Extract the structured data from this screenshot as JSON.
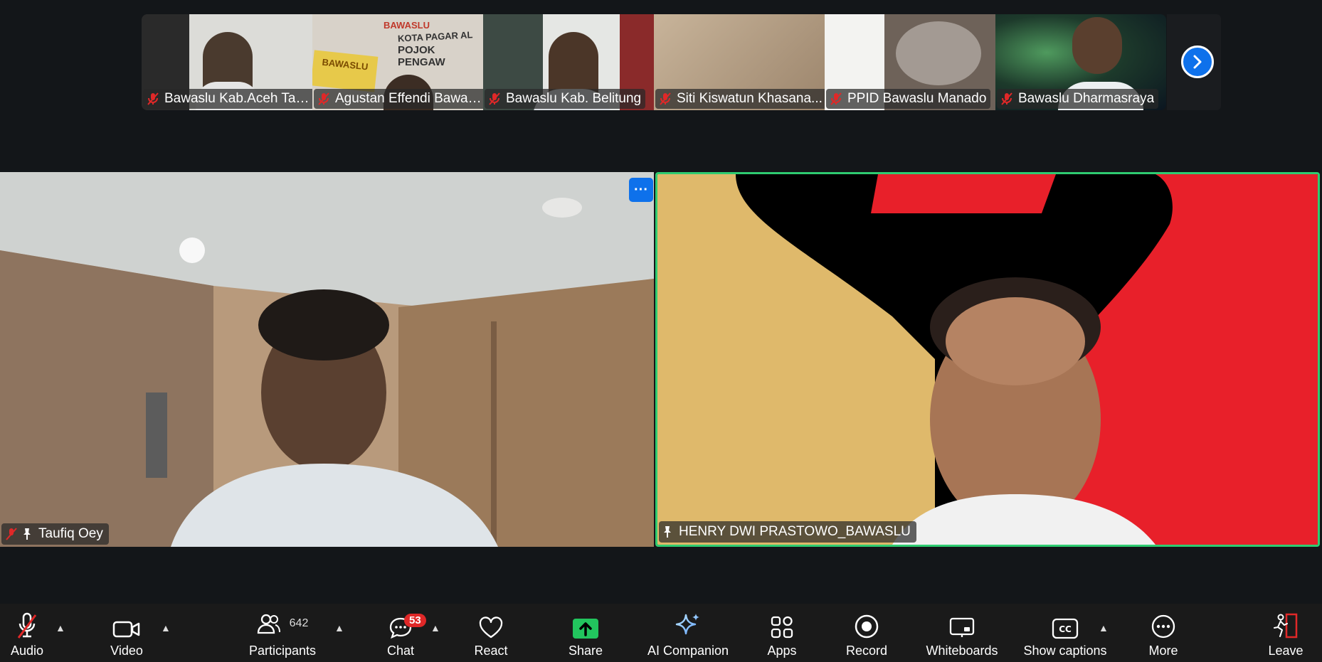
{
  "thumbnails": [
    {
      "name": "Bawaslu Kab.Aceh Tam...",
      "muted": true,
      "bg": "#c9c6c0"
    },
    {
      "name": "Agustan Effendi Bawas...",
      "muted": true,
      "bg": "#d8d2c9",
      "sign_lines": [
        "BAWASLU",
        "KOTA PAGAR AL",
        "POJOK PENGAW"
      ],
      "badge_text": "BAWASLU"
    },
    {
      "name": "Bawaslu Kab. Belitung",
      "muted": true,
      "bg": "#5b6b62"
    },
    {
      "name": "Siti Kiswatun Khasana...",
      "muted": true,
      "bg": "#b49d84"
    },
    {
      "name": "PPID Bawaslu Manado",
      "muted": true,
      "bg": "#8d8179"
    },
    {
      "name": "Bawaslu Dharmasraya",
      "muted": true,
      "bg": "#1f3b2c"
    }
  ],
  "main": {
    "left": {
      "name": "Taufiq Oey",
      "muted": true,
      "pinned": true
    },
    "right": {
      "name": "HENRY DWI PRASTOWO_BAWASLU",
      "pinned": true,
      "active_speaker": true
    }
  },
  "toolbar": {
    "audio": "Audio",
    "video": "Video",
    "participants": "Participants",
    "participants_count": "642",
    "chat": "Chat",
    "chat_badge": "53",
    "react": "React",
    "share": "Share",
    "ai_companion": "AI Companion",
    "apps": "Apps",
    "record": "Record",
    "whiteboards": "Whiteboards",
    "show_captions": "Show captions",
    "more": "More",
    "leave": "Leave"
  },
  "colors": {
    "accent_blue": "#0e71eb",
    "speaker_border": "#2ecc71",
    "mute_red": "#e02828",
    "share_green": "#22c55e"
  },
  "icons": [
    "mic-muted-icon",
    "camera-icon",
    "participants-icon",
    "chat-icon",
    "heart-icon",
    "share-arrow-icon",
    "sparkle-icon",
    "apps-icon",
    "record-icon",
    "whiteboard-icon",
    "cc-icon",
    "more-dots-icon",
    "leave-door-icon",
    "chevron-right-icon",
    "pin-icon"
  ]
}
